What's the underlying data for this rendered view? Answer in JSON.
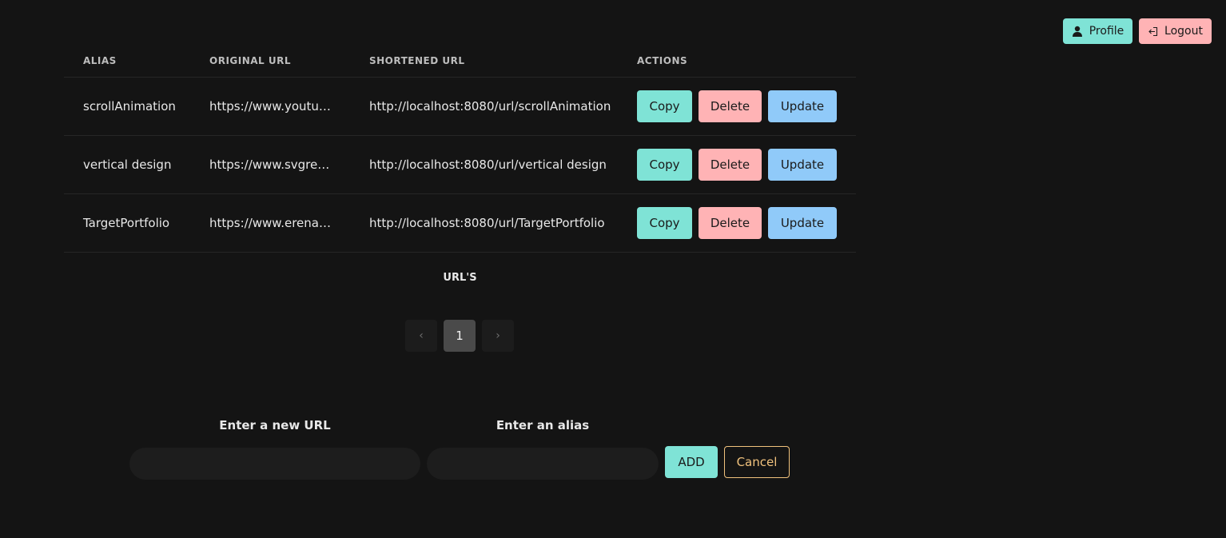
{
  "header": {
    "profile_label": "Profile",
    "logout_label": "Logout"
  },
  "table": {
    "columns": [
      "ALIAS",
      "ORIGINAL URL",
      "SHORTENED URL",
      "ACTIONS"
    ],
    "rows": [
      {
        "alias": "scrollAnimation",
        "original": "https://www.youtub...",
        "shortened": "http://localhost:8080/url/scrollAnimation"
      },
      {
        "alias": "vertical design",
        "original": "https://www.svgrep...",
        "shortened": "http://localhost:8080/url/vertical design"
      },
      {
        "alias": "TargetPortfolio",
        "original": "https://www.erenay...",
        "shortened": "http://localhost:8080/url/TargetPortfolio"
      }
    ],
    "action_labels": {
      "copy": "Copy",
      "delete": "Delete",
      "update": "Update"
    },
    "caption": "URL'S"
  },
  "pagination": {
    "prev": "‹",
    "current": "1",
    "next": "›"
  },
  "form": {
    "url_label": "Enter a new URL",
    "alias_label": "Enter an alias",
    "url_value": "",
    "alias_value": "",
    "add_label": "ADD",
    "cancel_label": "Cancel"
  },
  "colors": {
    "background": "#141414",
    "teal": "#7fe3d6",
    "pink": "#ffb3b5",
    "blue": "#90caf9",
    "gold": "#f1c27d"
  }
}
